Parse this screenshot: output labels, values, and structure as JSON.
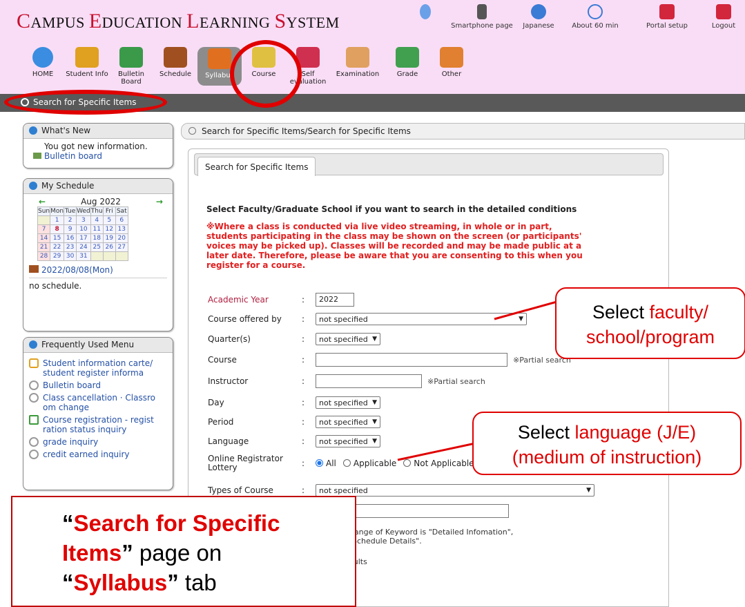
{
  "header": {
    "title_parts": [
      {
        "cap": "C",
        "rest": "AMPUS "
      },
      {
        "cap": "E",
        "rest": "DUCATION "
      },
      {
        "cap": "L",
        "rest": "EARNING "
      },
      {
        "cap": "S",
        "rest": "YSTEM"
      }
    ],
    "utility": [
      {
        "label": "",
        "icon": "user-icon",
        "color": "#6aa0e8"
      },
      {
        "label": "Smartphone page",
        "icon": "smartphone-icon",
        "color": "#555555"
      },
      {
        "label": "Japanese",
        "icon": "language-icon",
        "color": "#3a7bd5"
      },
      {
        "label": "About 60 min",
        "icon": "clock-icon",
        "color": "#3a7bd5"
      },
      {
        "label": "Portal setup",
        "icon": "tools-icon",
        "color": "#d2263d"
      },
      {
        "label": "Logout",
        "icon": "power-icon",
        "color": "#d2263d"
      }
    ],
    "nav": [
      {
        "label": "HOME",
        "icon": "home-icon",
        "color": "#3a8de0"
      },
      {
        "label": "Student Info",
        "icon": "student-icon",
        "color": "#e0a020"
      },
      {
        "label": "Bulletin Board",
        "icon": "board-icon",
        "color": "#3a9a4a"
      },
      {
        "label": "Schedule",
        "icon": "schedule-icon",
        "color": "#a05020"
      },
      {
        "label": "Syllabus",
        "icon": "syllabus-icon",
        "color": "#e07020"
      },
      {
        "label": "Course",
        "icon": "course-icon",
        "color": "#e0c040"
      },
      {
        "label": "Self evaluation",
        "icon": "self-evaluation-icon",
        "color": "#d03050"
      },
      {
        "label": "Examination",
        "icon": "examination-icon",
        "color": "#e0a060"
      },
      {
        "label": "Grade",
        "icon": "grade-icon",
        "color": "#40a050"
      },
      {
        "label": "Other",
        "icon": "other-icon",
        "color": "#e08030"
      }
    ],
    "active_nav": "Syllabus",
    "subbar_label": "Search for Specific Items"
  },
  "sidebar": {
    "whats_new": {
      "title": "What's New",
      "message": "You got new information.",
      "link": "Bulletin board"
    },
    "schedule": {
      "title": "My Schedule",
      "month": "Aug 2022",
      "weekdays": [
        "Sun",
        "Mon",
        "Tue",
        "Wed",
        "Thu",
        "Fri",
        "Sat"
      ],
      "weeks": [
        [
          "",
          "1",
          "2",
          "3",
          "4",
          "5",
          "6"
        ],
        [
          "7",
          "8",
          "9",
          "10",
          "11",
          "12",
          "13"
        ],
        [
          "14",
          "15",
          "16",
          "17",
          "18",
          "19",
          "20"
        ],
        [
          "21",
          "22",
          "23",
          "24",
          "25",
          "26",
          "27"
        ],
        [
          "28",
          "29",
          "30",
          "31",
          "",
          "",
          ""
        ]
      ],
      "today": "8",
      "date_label": "2022/08/08(Mon)",
      "status": "no schedule."
    },
    "frequent": {
      "title": "Frequently Used Menu",
      "items": [
        {
          "label": "Student information carte/ student register informa",
          "icon": "student-icon"
        },
        {
          "label": "Bulletin board",
          "icon": "search-icon"
        },
        {
          "label": "Class cancellation · Classro om change",
          "icon": "search-icon"
        },
        {
          "label": "Course registration - regist ration status inquiry",
          "icon": "pencil-icon"
        },
        {
          "label": "grade inquiry",
          "icon": "search-icon"
        },
        {
          "label": "credit earned inquiry",
          "icon": "search-icon"
        }
      ]
    }
  },
  "main": {
    "breadcrumb": "Search for Specific Items∕Search for Specific Items",
    "tab": "Search for Specific Items",
    "intro": "Select Faculty/Graduate School if you want to search in the detailed conditions",
    "notice": "※Where a class is conducted via live video streaming, in whole or in part, students participating in the class may be shown on the screen (or participants' voices may be picked up). Classes will be recorded and may be made public at a later date. Therefore, please be aware that you are consenting to this when you register for a course.",
    "fields": {
      "academic_year": {
        "label": "Academic Year",
        "value": "2022"
      },
      "course_offered_by": {
        "label": "Course offered by",
        "value": "not specified"
      },
      "quarters": {
        "label": "Quarter(s)",
        "value": "not specified"
      },
      "course": {
        "label": "Course",
        "value": "",
        "hint": "※Partial search"
      },
      "instructor": {
        "label": "Instructor",
        "value": "",
        "hint": "※Partial search"
      },
      "day": {
        "label": "Day",
        "value": "not specified"
      },
      "period": {
        "label": "Period",
        "value": "not specified"
      },
      "language": {
        "label": "Language",
        "value": "not specified"
      },
      "lottery": {
        "label": "Online Registrator Lottery",
        "options": [
          "All",
          "Applicable",
          "Not Applicable"
        ],
        "selected": "All"
      },
      "types_of_course": {
        "label": "Types of Course",
        "value": "not specified"
      }
    },
    "keyword_note_1": "h Range of Keyword is \"Detailed Infomation\",",
    "keyword_note_2": "ss Schedule Details\".",
    "results_text": "results"
  },
  "annotations": {
    "callout_faculty": {
      "black": "Select ",
      "red": "faculty/ school/program"
    },
    "callout_language": {
      "black": "Select ",
      "red": "language (J/E)",
      "line2": "(medium of instruction)"
    },
    "big_note": {
      "q1": "“",
      "p1": "Search for Specific Items",
      "q2": "”",
      "p2": " page on",
      "q3": "“",
      "p3": "Syllabus",
      "q4": "”",
      "p4": " tab"
    }
  }
}
